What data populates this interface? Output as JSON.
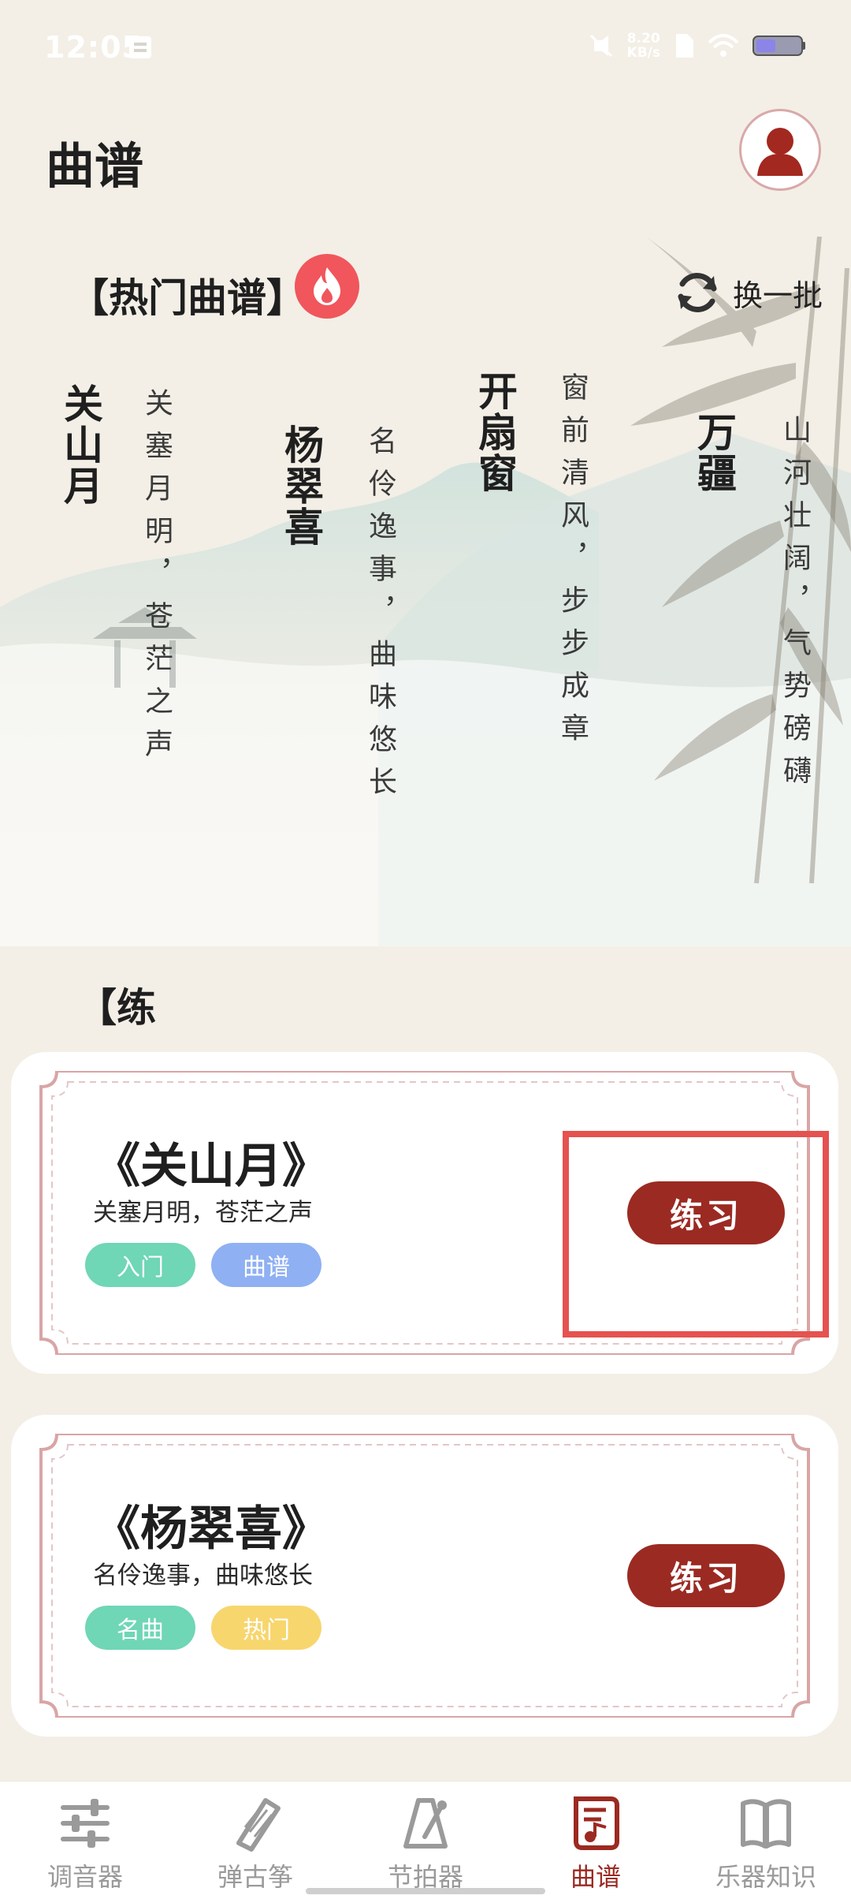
{
  "status": {
    "time": "12:05",
    "net_speed_value": "8.20",
    "net_speed_unit": "KB/s"
  },
  "header": {
    "title": "曲谱"
  },
  "hot": {
    "title": "【热门曲谱】",
    "refresh_label": "换一批",
    "songs": [
      {
        "title": "关山月",
        "desc": "关塞月明，苍茫之声"
      },
      {
        "title": "杨翠喜",
        "desc": "名伶逸事，曲味悠长"
      },
      {
        "title": "开扇窗",
        "desc": "窗前清风，步步成章"
      },
      {
        "title": "万疆",
        "desc": "山河壮阔，气势磅礴"
      }
    ]
  },
  "practice": {
    "heading": "【练",
    "cards": [
      {
        "title": "《关山月》",
        "desc": "关塞月明，苍茫之声",
        "tags": [
          "入门",
          "曲谱"
        ],
        "button": "练习"
      },
      {
        "title": "《杨翠喜》",
        "desc": "名伶逸事，曲味悠长",
        "tags": [
          "名曲",
          "热门"
        ],
        "button": "练习"
      }
    ]
  },
  "nav": {
    "items": [
      {
        "label": "调音器",
        "icon": "tuner-sliders-icon"
      },
      {
        "label": "弹古筝",
        "icon": "guzheng-icon"
      },
      {
        "label": "节拍器",
        "icon": "metronome-icon"
      },
      {
        "label": "曲谱",
        "icon": "sheet-music-scroll-icon",
        "active": true
      },
      {
        "label": "乐器知识",
        "icon": "book-icon"
      }
    ]
  },
  "colors": {
    "accent": "#9B2A22",
    "background": "#F3EFE6",
    "tag_green": "#6FD6B6",
    "tag_blue": "#8FB0F2",
    "tag_yellow": "#F7D66E",
    "highlight": "#E5524F"
  }
}
